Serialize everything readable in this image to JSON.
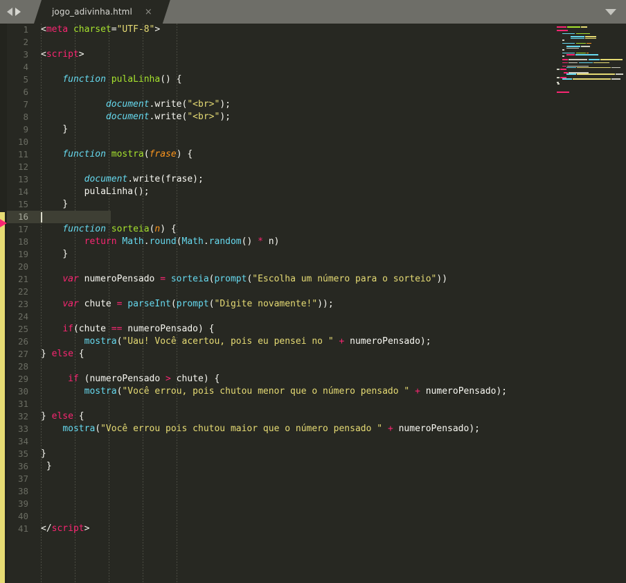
{
  "window": {
    "title": "jogo_adivinha.html",
    "theme": "monokai-dark"
  },
  "tabbar": {
    "nav_prev_icon": "triangle-left-icon",
    "nav_next_icon": "triangle-right-icon",
    "tab_label": "jogo_adivinha.html",
    "close_icon": "×",
    "menu_icon": "chevron-down-icon"
  },
  "editor": {
    "language": "HTML / JavaScript",
    "active_line": 16,
    "total_lines": 41,
    "cursor_line": 16,
    "cursor_column": 1,
    "indent_guides": true,
    "gutter_marker": "red-arrow-icon",
    "modified_bar_color": "#e6db74",
    "background_color": "#272822",
    "line_numbers": [
      1,
      2,
      3,
      4,
      5,
      6,
      7,
      8,
      9,
      10,
      11,
      12,
      13,
      14,
      15,
      16,
      17,
      18,
      19,
      20,
      21,
      22,
      23,
      24,
      25,
      26,
      27,
      28,
      29,
      30,
      31,
      32,
      33,
      34,
      35,
      36,
      37,
      38,
      39,
      40,
      41
    ],
    "code_lines": [
      {
        "n": 1,
        "tokens": [
          {
            "t": "<",
            "c": "t-punc"
          },
          {
            "t": "meta",
            "c": "t-tag"
          },
          {
            "t": " ",
            "c": "t-plain"
          },
          {
            "t": "charset",
            "c": "t-attr"
          },
          {
            "t": "=",
            "c": "t-plain"
          },
          {
            "t": "\"UTF-8\"",
            "c": "t-str"
          },
          {
            "t": ">",
            "c": "t-punc"
          }
        ]
      },
      {
        "n": 2,
        "tokens": []
      },
      {
        "n": 3,
        "tokens": [
          {
            "t": "<",
            "c": "t-punc"
          },
          {
            "t": "script",
            "c": "t-tag"
          },
          {
            "t": ">",
            "c": "t-punc"
          }
        ]
      },
      {
        "n": 4,
        "tokens": []
      },
      {
        "n": 5,
        "tokens": [
          {
            "t": "    ",
            "c": "t-plain"
          },
          {
            "t": "function",
            "c": "t-fnkw"
          },
          {
            "t": " ",
            "c": "t-plain"
          },
          {
            "t": "pulaLinha",
            "c": "t-fname"
          },
          {
            "t": "() {",
            "c": "t-plain"
          }
        ]
      },
      {
        "n": 6,
        "tokens": []
      },
      {
        "n": 7,
        "tokens": [
          {
            "t": "            ",
            "c": "t-plain"
          },
          {
            "t": "document",
            "c": "t-obj"
          },
          {
            "t": ".write(",
            "c": "t-plain"
          },
          {
            "t": "\"<br>\"",
            "c": "t-str"
          },
          {
            "t": ");",
            "c": "t-plain"
          }
        ]
      },
      {
        "n": 8,
        "tokens": [
          {
            "t": "            ",
            "c": "t-plain"
          },
          {
            "t": "document",
            "c": "t-obj"
          },
          {
            "t": ".write(",
            "c": "t-plain"
          },
          {
            "t": "\"<br>\"",
            "c": "t-str"
          },
          {
            "t": ");",
            "c": "t-plain"
          }
        ]
      },
      {
        "n": 9,
        "tokens": [
          {
            "t": "    }",
            "c": "t-plain"
          }
        ]
      },
      {
        "n": 10,
        "tokens": []
      },
      {
        "n": 11,
        "tokens": [
          {
            "t": "    ",
            "c": "t-plain"
          },
          {
            "t": "function",
            "c": "t-fnkw"
          },
          {
            "t": " ",
            "c": "t-plain"
          },
          {
            "t": "mostra",
            "c": "t-fname"
          },
          {
            "t": "(",
            "c": "t-plain"
          },
          {
            "t": "frase",
            "c": "t-param"
          },
          {
            "t": ") {",
            "c": "t-plain"
          }
        ]
      },
      {
        "n": 12,
        "tokens": []
      },
      {
        "n": 13,
        "tokens": [
          {
            "t": "        ",
            "c": "t-plain"
          },
          {
            "t": "document",
            "c": "t-obj"
          },
          {
            "t": ".write(frase);",
            "c": "t-plain"
          }
        ]
      },
      {
        "n": 14,
        "tokens": [
          {
            "t": "        pulaLinha();",
            "c": "t-plain"
          }
        ]
      },
      {
        "n": 15,
        "tokens": [
          {
            "t": "    }",
            "c": "t-plain"
          }
        ]
      },
      {
        "n": 16,
        "tokens": []
      },
      {
        "n": 17,
        "tokens": [
          {
            "t": "    ",
            "c": "t-plain"
          },
          {
            "t": "function",
            "c": "t-fnkw"
          },
          {
            "t": " ",
            "c": "t-plain"
          },
          {
            "t": "sorteia",
            "c": "t-fname"
          },
          {
            "t": "(",
            "c": "t-plain"
          },
          {
            "t": "n",
            "c": "t-param"
          },
          {
            "t": ") {",
            "c": "t-plain"
          }
        ]
      },
      {
        "n": 18,
        "tokens": [
          {
            "t": "        ",
            "c": "t-plain"
          },
          {
            "t": "return",
            "c": "t-kw2"
          },
          {
            "t": " ",
            "c": "t-plain"
          },
          {
            "t": "Math",
            "c": "t-call"
          },
          {
            "t": ".",
            "c": "t-plain"
          },
          {
            "t": "round",
            "c": "t-call"
          },
          {
            "t": "(",
            "c": "t-plain"
          },
          {
            "t": "Math",
            "c": "t-call"
          },
          {
            "t": ".",
            "c": "t-plain"
          },
          {
            "t": "random",
            "c": "t-call"
          },
          {
            "t": "() ",
            "c": "t-plain"
          },
          {
            "t": "*",
            "c": "t-op"
          },
          {
            "t": " n)",
            "c": "t-plain"
          }
        ]
      },
      {
        "n": 19,
        "tokens": [
          {
            "t": "    }",
            "c": "t-plain"
          }
        ]
      },
      {
        "n": 20,
        "tokens": []
      },
      {
        "n": 21,
        "tokens": [
          {
            "t": "    ",
            "c": "t-plain"
          },
          {
            "t": "var",
            "c": "t-kw"
          },
          {
            "t": " numeroPensado ",
            "c": "t-plain"
          },
          {
            "t": "=",
            "c": "t-op"
          },
          {
            "t": " ",
            "c": "t-plain"
          },
          {
            "t": "sorteia",
            "c": "t-call"
          },
          {
            "t": "(",
            "c": "t-plain"
          },
          {
            "t": "prompt",
            "c": "t-call"
          },
          {
            "t": "(",
            "c": "t-plain"
          },
          {
            "t": "\"Escolha um número para o sorteio\"",
            "c": "t-str"
          },
          {
            "t": "))",
            "c": "t-plain"
          }
        ]
      },
      {
        "n": 22,
        "tokens": []
      },
      {
        "n": 23,
        "tokens": [
          {
            "t": "    ",
            "c": "t-plain"
          },
          {
            "t": "var",
            "c": "t-kw"
          },
          {
            "t": " chute ",
            "c": "t-plain"
          },
          {
            "t": "=",
            "c": "t-op"
          },
          {
            "t": " ",
            "c": "t-plain"
          },
          {
            "t": "parseInt",
            "c": "t-call"
          },
          {
            "t": "(",
            "c": "t-plain"
          },
          {
            "t": "prompt",
            "c": "t-call"
          },
          {
            "t": "(",
            "c": "t-plain"
          },
          {
            "t": "\"Digite novamente!\"",
            "c": "t-str"
          },
          {
            "t": "));",
            "c": "t-plain"
          }
        ]
      },
      {
        "n": 24,
        "tokens": []
      },
      {
        "n": 25,
        "tokens": [
          {
            "t": "    ",
            "c": "t-plain"
          },
          {
            "t": "if",
            "c": "t-kw2"
          },
          {
            "t": "(chute ",
            "c": "t-plain"
          },
          {
            "t": "==",
            "c": "t-op"
          },
          {
            "t": " numeroPensado) {",
            "c": "t-plain"
          }
        ]
      },
      {
        "n": 26,
        "tokens": [
          {
            "t": "        ",
            "c": "t-plain"
          },
          {
            "t": "mostra",
            "c": "t-call"
          },
          {
            "t": "(",
            "c": "t-plain"
          },
          {
            "t": "\"Uau! Você acertou, pois eu pensei no \"",
            "c": "t-str"
          },
          {
            "t": " ",
            "c": "t-plain"
          },
          {
            "t": "+",
            "c": "t-op"
          },
          {
            "t": " numeroPensado);",
            "c": "t-plain"
          }
        ]
      },
      {
        "n": 27,
        "tokens": [
          {
            "t": "} ",
            "c": "t-plain"
          },
          {
            "t": "else",
            "c": "t-kw2"
          },
          {
            "t": " {",
            "c": "t-plain"
          }
        ]
      },
      {
        "n": 28,
        "tokens": []
      },
      {
        "n": 29,
        "tokens": [
          {
            "t": "     ",
            "c": "t-plain"
          },
          {
            "t": "if",
            "c": "t-kw2"
          },
          {
            "t": " (numeroPensado ",
            "c": "t-plain"
          },
          {
            "t": ">",
            "c": "t-op"
          },
          {
            "t": " chute) {",
            "c": "t-plain"
          }
        ]
      },
      {
        "n": 30,
        "tokens": [
          {
            "t": "        ",
            "c": "t-plain"
          },
          {
            "t": "mostra",
            "c": "t-call"
          },
          {
            "t": "(",
            "c": "t-plain"
          },
          {
            "t": "\"Você errou, pois chutou menor que o número pensado \"",
            "c": "t-str"
          },
          {
            "t": " ",
            "c": "t-plain"
          },
          {
            "t": "+",
            "c": "t-op"
          },
          {
            "t": " numeroPensado);",
            "c": "t-plain"
          }
        ]
      },
      {
        "n": 31,
        "tokens": []
      },
      {
        "n": 32,
        "tokens": [
          {
            "t": "} ",
            "c": "t-plain"
          },
          {
            "t": "else",
            "c": "t-kw2"
          },
          {
            "t": " {",
            "c": "t-plain"
          }
        ]
      },
      {
        "n": 33,
        "tokens": [
          {
            "t": "    ",
            "c": "t-plain"
          },
          {
            "t": "mostra",
            "c": "t-call"
          },
          {
            "t": "(",
            "c": "t-plain"
          },
          {
            "t": "\"Você errou pois chutou maior que o número pensado \"",
            "c": "t-str"
          },
          {
            "t": " ",
            "c": "t-plain"
          },
          {
            "t": "+",
            "c": "t-op"
          },
          {
            "t": " numeroPensado);",
            "c": "t-plain"
          }
        ]
      },
      {
        "n": 34,
        "tokens": []
      },
      {
        "n": 35,
        "tokens": [
          {
            "t": "}",
            "c": "t-plain"
          }
        ]
      },
      {
        "n": 36,
        "tokens": [
          {
            "t": " }",
            "c": "t-plain"
          }
        ]
      },
      {
        "n": 37,
        "tokens": []
      },
      {
        "n": 38,
        "tokens": []
      },
      {
        "n": 39,
        "tokens": []
      },
      {
        "n": 40,
        "tokens": []
      },
      {
        "n": 41,
        "tokens": [
          {
            "t": "</",
            "c": "t-punc"
          },
          {
            "t": "script",
            "c": "t-tag"
          },
          {
            "t": ">",
            "c": "t-punc"
          }
        ]
      }
    ],
    "indent_guide_positions": [
      14,
      63,
      112,
      161,
      210
    ]
  },
  "minimap": {
    "rows": [
      [
        [
          0,
          14,
          "#f92672"
        ],
        [
          15,
          34,
          "#a6e22e"
        ],
        [
          35,
          44,
          "#e6db74"
        ]
      ],
      [],
      [
        [
          0,
          16,
          "#f92672"
        ]
      ],
      [],
      [
        [
          8,
          26,
          "#66d9ef"
        ],
        [
          28,
          48,
          "#a6e22e"
        ]
      ],
      [],
      [
        [
          20,
          40,
          "#66d9ef"
        ],
        [
          41,
          57,
          "#e6db74"
        ]
      ],
      [
        [
          20,
          40,
          "#66d9ef"
        ],
        [
          41,
          57,
          "#e6db74"
        ]
      ],
      [
        [
          8,
          11,
          "#cfcfc2"
        ]
      ],
      [],
      [
        [
          8,
          26,
          "#66d9ef"
        ],
        [
          28,
          42,
          "#a6e22e"
        ],
        [
          43,
          50,
          "#fd971f"
        ]
      ],
      [],
      [
        [
          14,
          34,
          "#66d9ef"
        ],
        [
          35,
          48,
          "#cfcfc2"
        ]
      ],
      [
        [
          14,
          32,
          "#cfcfc2"
        ]
      ],
      [
        [
          8,
          11,
          "#cfcfc2"
        ]
      ],
      [],
      [
        [
          8,
          26,
          "#66d9ef"
        ],
        [
          28,
          42,
          "#a6e22e"
        ],
        [
          43,
          46,
          "#fd971f"
        ]
      ],
      [
        [
          14,
          26,
          "#f92672"
        ],
        [
          27,
          60,
          "#66d9ef"
        ]
      ],
      [
        [
          8,
          11,
          "#cfcfc2"
        ]
      ],
      [],
      [
        [
          8,
          16,
          "#f92672"
        ],
        [
          17,
          44,
          "#cfcfc2"
        ],
        [
          46,
          62,
          "#66d9ef"
        ],
        [
          63,
          95,
          "#e6db74"
        ]
      ],
      [],
      [
        [
          8,
          16,
          "#f92672"
        ],
        [
          17,
          30,
          "#cfcfc2"
        ],
        [
          32,
          52,
          "#66d9ef"
        ],
        [
          53,
          76,
          "#e6db74"
        ]
      ],
      [],
      [
        [
          8,
          14,
          "#f92672"
        ],
        [
          15,
          46,
          "#cfcfc2"
        ]
      ],
      [
        [
          14,
          28,
          "#66d9ef"
        ],
        [
          29,
          78,
          "#e6db74"
        ],
        [
          79,
          92,
          "#cfcfc2"
        ]
      ],
      [
        [
          0,
          4,
          "#cfcfc2"
        ],
        [
          5,
          14,
          "#f92672"
        ]
      ],
      [],
      [
        [
          10,
          16,
          "#f92672"
        ],
        [
          17,
          46,
          "#cfcfc2"
        ]
      ],
      [
        [
          14,
          28,
          "#66d9ef"
        ],
        [
          29,
          84,
          "#e6db74"
        ],
        [
          85,
          96,
          "#cfcfc2"
        ]
      ],
      [],
      [
        [
          0,
          4,
          "#cfcfc2"
        ],
        [
          5,
          14,
          "#f92672"
        ]
      ],
      [
        [
          8,
          22,
          "#66d9ef"
        ],
        [
          23,
          78,
          "#e6db74"
        ],
        [
          79,
          92,
          "#cfcfc2"
        ]
      ],
      [],
      [
        [
          0,
          3,
          "#cfcfc2"
        ]
      ],
      [
        [
          1,
          4,
          "#cfcfc2"
        ]
      ],
      [],
      [],
      [],
      [],
      [
        [
          0,
          18,
          "#f92672"
        ]
      ]
    ]
  }
}
